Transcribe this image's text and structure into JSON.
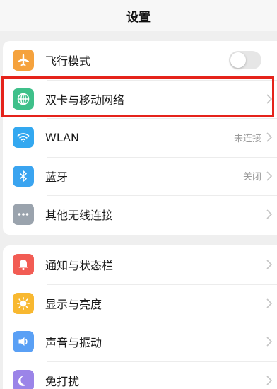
{
  "header": {
    "title": "设置"
  },
  "colors": {
    "highlight": "#e5231b",
    "airplane": "#f5a23d",
    "network": "#3fc08a",
    "wlan": "#33a8f0",
    "bluetooth": "#3aa4f0",
    "more": "#9aa3ad",
    "notify": "#f25c54",
    "display": "#f8b830",
    "sound": "#5aa0f5",
    "dnd": "#9b84e8"
  },
  "settings": {
    "airplane": {
      "label": "飞行模式",
      "icon": "airplane-icon",
      "toggle_on": false
    },
    "network": {
      "label": "双卡与移动网络",
      "icon": "globe-icon"
    },
    "wlan": {
      "label": "WLAN",
      "value": "未连接",
      "icon": "wifi-icon"
    },
    "bluetooth": {
      "label": "蓝牙",
      "value": "关闭",
      "icon": "bluetooth-icon"
    },
    "more_wireless": {
      "label": "其他无线连接",
      "icon": "more-dots-icon"
    },
    "notify": {
      "label": "通知与状态栏",
      "icon": "notification-icon"
    },
    "display": {
      "label": "显示与亮度",
      "icon": "sun-icon"
    },
    "sound": {
      "label": "声音与振动",
      "icon": "speaker-icon"
    },
    "dnd": {
      "label": "免打扰",
      "icon": "moon-icon"
    }
  }
}
